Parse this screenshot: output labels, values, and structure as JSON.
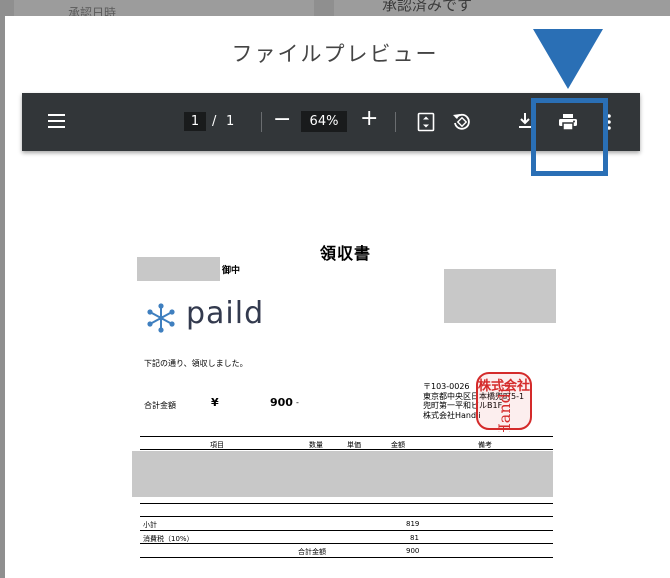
{
  "background": {
    "left_text": "承認日時",
    "right_text": "承認済みです"
  },
  "modal": {
    "title": "ファイルプレビュー"
  },
  "toolbar": {
    "current_page": "1",
    "page_separator": "/",
    "total_pages": "1",
    "zoom_minus": "−",
    "zoom_level": "64%",
    "zoom_plus": "+"
  },
  "document": {
    "title": "領収書",
    "addressee_suffix": "御中",
    "logo_text": "paild",
    "intro": "下記の通り、領収しました。",
    "total_label": "合計金額",
    "currency": "¥",
    "total_amount": "900",
    "total_suffix": "-",
    "address_lines": [
      "〒103-0026",
      "東京都中央区日本橋兜町5-1",
      "兜町第一平和ビルB1F",
      "株式会社Handii"
    ],
    "stamp_text": "株式会社",
    "stamp_name": "Handii",
    "table_headers": {
      "item": "項目",
      "quantity": "数量",
      "unit_price": "単価",
      "amount": "金額",
      "remarks": "備考"
    },
    "subtotal_label": "小計",
    "subtotal_value": "819",
    "tax_label": "消費税（10%）",
    "tax_value": "81",
    "grand_total_label": "合計金額",
    "grand_total_value": "900"
  },
  "colors": {
    "toolbar_bg": "#323639",
    "highlight": "#2a6fb5",
    "stamp_red": "#d42a2a"
  }
}
